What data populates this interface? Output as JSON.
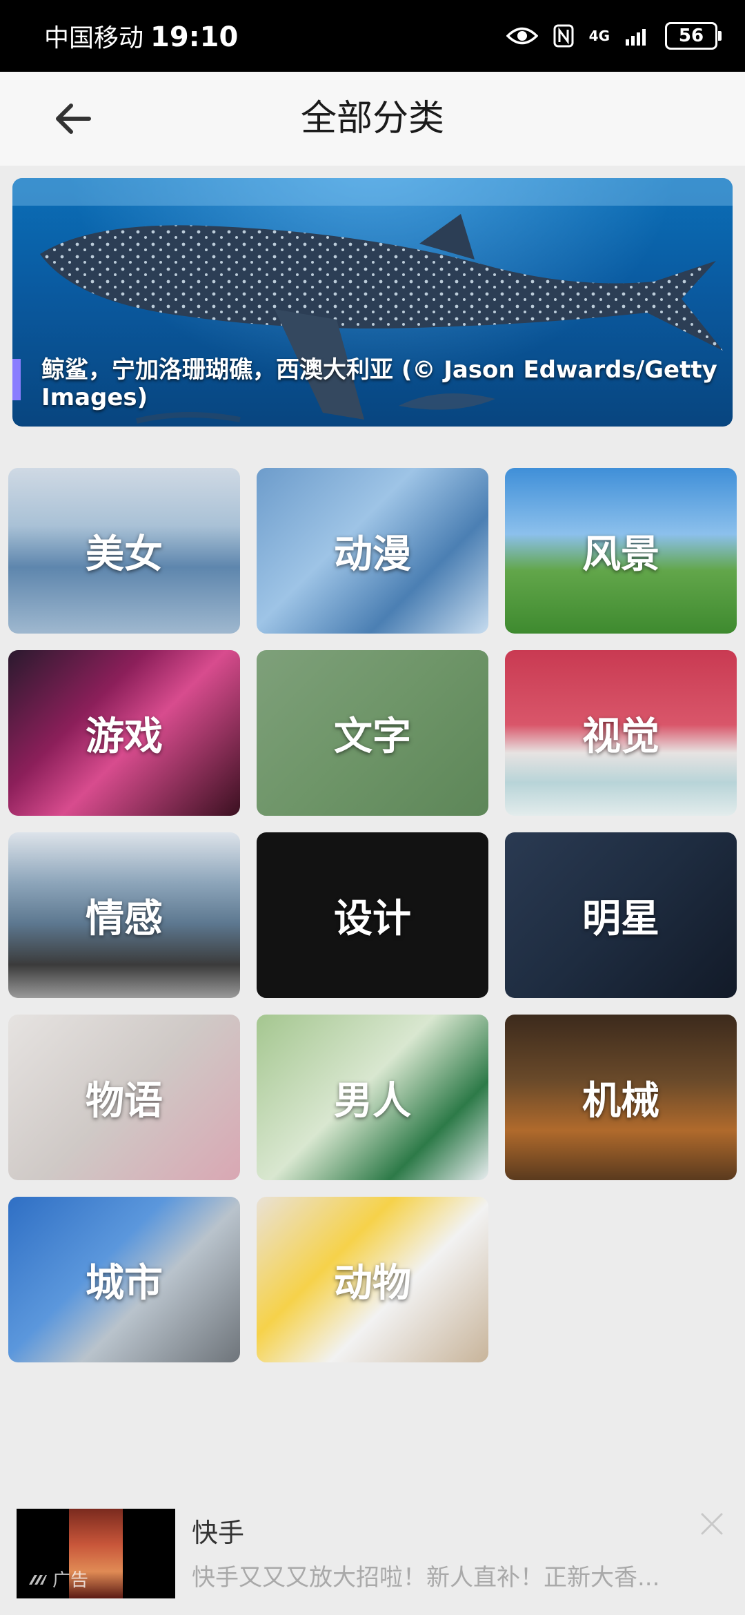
{
  "status_bar": {
    "carrier": "中国移动",
    "time": "19:10",
    "network": "4G",
    "battery": "56"
  },
  "header": {
    "title": "全部分类"
  },
  "banner": {
    "caption": "鲸鲨，宁加洛珊瑚礁，西澳大利亚 (© Jason Edwards/Getty Images)"
  },
  "categories": [
    {
      "label": "美女",
      "icon": "beauty-thumbnail"
    },
    {
      "label": "动漫",
      "icon": "anime-thumbnail"
    },
    {
      "label": "风景",
      "icon": "scenery-thumbnail"
    },
    {
      "label": "游戏",
      "icon": "game-thumbnail"
    },
    {
      "label": "文字",
      "icon": "text-thumbnail"
    },
    {
      "label": "视觉",
      "icon": "visual-thumbnail"
    },
    {
      "label": "情感",
      "icon": "emotion-thumbnail"
    },
    {
      "label": "设计",
      "icon": "design-thumbnail"
    },
    {
      "label": "明星",
      "icon": "star-thumbnail"
    },
    {
      "label": "物语",
      "icon": "story-thumbnail"
    },
    {
      "label": "男人",
      "icon": "men-thumbnail"
    },
    {
      "label": "机械",
      "icon": "machine-thumbnail"
    },
    {
      "label": "城市",
      "icon": "city-thumbnail"
    },
    {
      "label": "动物",
      "icon": "animal-thumbnail"
    }
  ],
  "ad": {
    "mark": "广告",
    "title": "快手",
    "description": "快手又又又放大招啦！新人直补！正新大香..."
  }
}
